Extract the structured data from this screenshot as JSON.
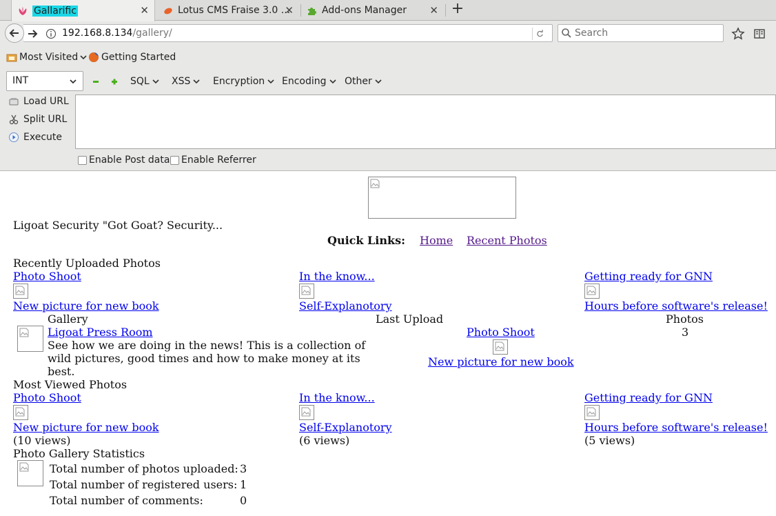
{
  "browser": {
    "tabs": [
      {
        "label": "Gallarific",
        "active": true
      },
      {
        "label": "Lotus CMS Fraise 3.0 ...",
        "active": false
      },
      {
        "label": "Add-ons Manager",
        "active": false
      }
    ],
    "url_host": "192.168.8.134",
    "url_path": "/gallery/",
    "search_placeholder": "Search",
    "bookmarks": [
      "Most Visited",
      "Getting Started"
    ]
  },
  "hackbar": {
    "select_value": "INT",
    "menus": [
      "SQL",
      "XSS",
      "Encryption",
      "Encoding",
      "Other"
    ],
    "actions": [
      "Load URL",
      "Split URL",
      "Execute"
    ],
    "checkboxes": [
      "Enable Post data",
      "Enable Referrer"
    ]
  },
  "page": {
    "tagline": "Ligoat Security \"Got Goat? Security...",
    "quick_links_label": "Quick Links:",
    "quick_links": [
      "Home",
      "Recent Photos"
    ],
    "recent_heading": "Recently Uploaded Photos",
    "recent": [
      {
        "album": "Photo Shoot",
        "title": "New picture for new book"
      },
      {
        "album": "In the know...",
        "title": "Self-Explanotory"
      },
      {
        "album": "Getting ready for GNN",
        "title": "Hours before software's release!"
      }
    ],
    "gallery_header": {
      "gallery": "Gallery",
      "last_upload": "Last Upload",
      "photos": "Photos"
    },
    "gallery_row": {
      "name": "Ligoat Press Room",
      "description_lines": [
        "See how we are doing in the news! This is a collection of",
        "wild pictures, good times and how to make money at its",
        "best."
      ],
      "last_album": "Photo Shoot",
      "last_title": "New picture for new book",
      "photos": "3"
    },
    "viewed_heading": "Most Viewed Photos",
    "viewed": [
      {
        "album": "Photo Shoot",
        "title": "New picture for new book",
        "views": "(10 views)"
      },
      {
        "album": "In the know...",
        "title": "Self-Explanotory",
        "views": "(6 views)"
      },
      {
        "album": "Getting ready for GNN",
        "title": "Hours before software's release!",
        "views": "(5 views)"
      }
    ],
    "stats_heading": "Photo Gallery Statistics",
    "stats": [
      {
        "label": "Total number of photos uploaded:",
        "value": "3"
      },
      {
        "label": "Total number of registered users:",
        "value": "1"
      },
      {
        "label": "Total number of comments:",
        "value": "0"
      }
    ]
  },
  "colors": {
    "tab_highlight": "#19d7e6",
    "link": "#0000ee",
    "visited": "#551a8b"
  }
}
